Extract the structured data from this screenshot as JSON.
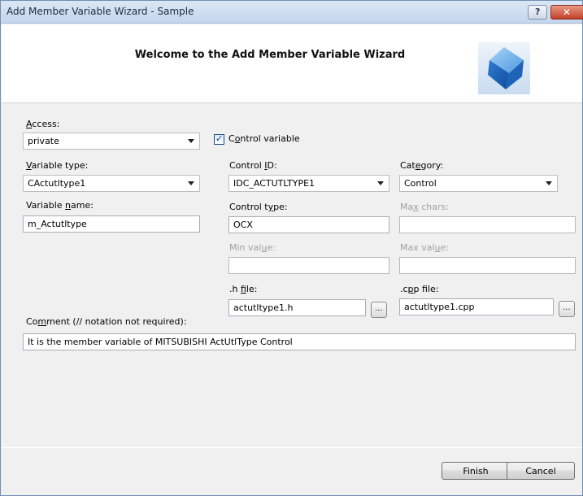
{
  "window": {
    "title": "Add Member Variable Wizard - Sample"
  },
  "titlebar": {
    "help_glyph": "?",
    "close_glyph": "✕"
  },
  "banner": {
    "heading": "Welcome to the Add Member Variable Wizard",
    "logo_icon": "wizard-cube-icon"
  },
  "form": {
    "access": {
      "label_key": "A",
      "label_rest": "ccess:",
      "value": "private"
    },
    "control_variable": {
      "label_pre": "C",
      "label_key": "o",
      "label_rest": "ntrol variable",
      "checked": true,
      "check_glyph": "✓"
    },
    "variable_type": {
      "label_key": "V",
      "label_rest": "ariable type:",
      "value": "CActutltype1"
    },
    "control_id": {
      "label_pre": "Control ",
      "label_key": "I",
      "label_rest": "D:",
      "value": "IDC_ACTUTLTYPE1"
    },
    "category": {
      "label_pre": "Cat",
      "label_key": "e",
      "label_rest": "gory:",
      "value": "Control"
    },
    "variable_name": {
      "label_pre": "Variable ",
      "label_key": "n",
      "label_rest": "ame:",
      "value": "m_Actutltype"
    },
    "control_type": {
      "label_pre": "Control t",
      "label_key": "y",
      "label_rest": "pe:",
      "value": "OCX"
    },
    "max_chars": {
      "label_pre": "Ma",
      "label_key": "x",
      "label_rest": " chars:",
      "value": ""
    },
    "min_value": {
      "label_pre": "Min val",
      "label_key": "u",
      "label_rest": "e:",
      "value": ""
    },
    "max_value": {
      "label_pre": "Max val",
      "label_key": "u",
      "label_rest": "e:",
      "value": ""
    },
    "h_file": {
      "label_pre": ".h ",
      "label_key": "f",
      "label_rest": "ile:",
      "value": "actutltype1.h",
      "browse_label": "..."
    },
    "cpp_file": {
      "label_pre": ".c",
      "label_key": "p",
      "label_rest": "p file:",
      "value": "actutltype1.cpp",
      "browse_label": "..."
    },
    "comment": {
      "label_pre": "Co",
      "label_key": "m",
      "label_rest": "ment (// notation not required):",
      "value": "It is the member variable of MITSUBISHI  ActUtlType Control"
    }
  },
  "buttons": {
    "finish": "Finish",
    "cancel": "Cancel"
  }
}
